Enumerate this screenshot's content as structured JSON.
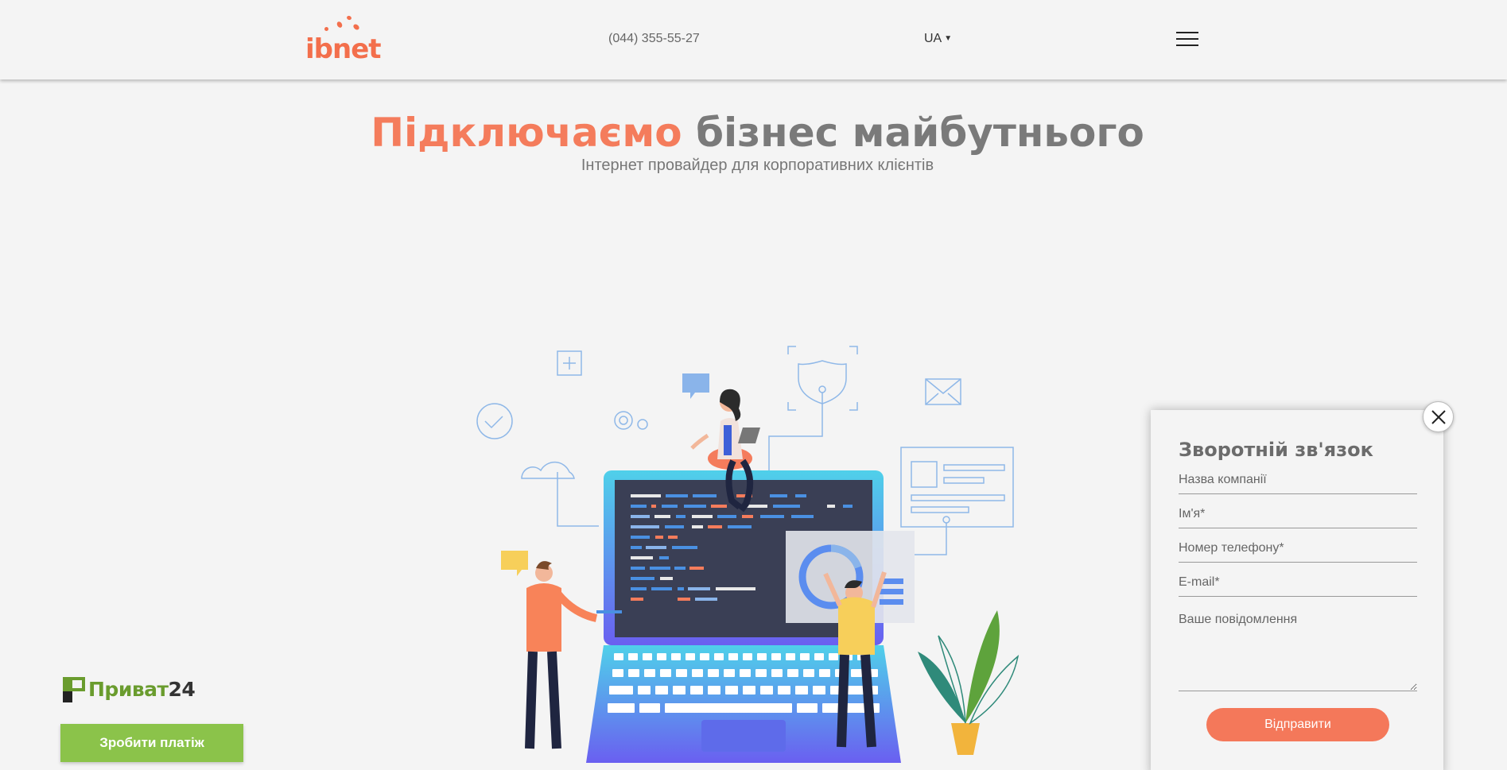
{
  "header": {
    "logo_text": "ibnet",
    "phone": "(044) 355-55-27",
    "language": "UA",
    "menu_icon": "hamburger-icon"
  },
  "hero": {
    "title_accent": "Підключаємо",
    "title_rest": "бізнес майбутнього",
    "subtitle": "Інтернет провайдер для корпоративних клієнтів"
  },
  "privat": {
    "logo_word": "Приват",
    "logo_number": "24",
    "pay_button": "Зробити платіж"
  },
  "feedback": {
    "title": "Зворотній зв'язок",
    "company_placeholder": "Назва компанії",
    "name_placeholder": "Ім'я*",
    "phone_placeholder": "Номер телефону*",
    "email_placeholder": "E-mail*",
    "message_placeholder": "Ваше повідомлення",
    "submit_label": "Відправити",
    "close_icon": "close-icon"
  },
  "colors": {
    "brand": "#f36f4c",
    "accent_title": "#f47c5c",
    "privat_green": "#8bc34a",
    "text_gray": "#7a7a7a"
  }
}
